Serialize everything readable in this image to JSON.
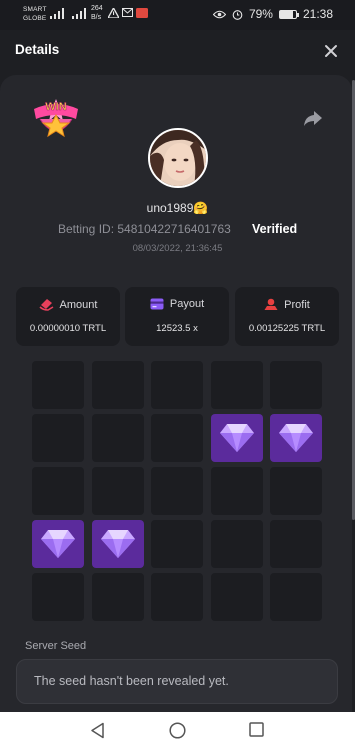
{
  "status_bar": {
    "carrier_line1": "SMART",
    "carrier_line2": "GLOBE",
    "net_speed_value": "264",
    "net_speed_unit": "B/s",
    "battery": "79%",
    "time": "21:38",
    "battery_level": 0.79
  },
  "header": {
    "title": "Details"
  },
  "bet": {
    "username": "uno1989🤗",
    "betting_id_label": "Betting ID:",
    "betting_id": "54810422716401763",
    "verified": "Verified",
    "datetime": "08/03/2022, 21:36:45",
    "badge_text": "WIN"
  },
  "stats": {
    "amount": {
      "label": "Amount",
      "value": "0.00000010 TRTL"
    },
    "payout": {
      "label": "Payout",
      "value": "12523.5 x"
    },
    "profit": {
      "label": "Profit",
      "value": "0.00125225 TRTL"
    }
  },
  "grid": {
    "rows": 5,
    "cols": 5,
    "gems": [
      [
        1,
        3
      ],
      [
        1,
        4
      ],
      [
        3,
        0
      ],
      [
        3,
        1
      ]
    ]
  },
  "server_seed": {
    "label": "Server Seed",
    "value": "The seed hasn't been revealed yet."
  },
  "colors": {
    "gem_tile": "#5b2b9c",
    "tile": "#1c1d21",
    "panel": "#26272c",
    "amount_icon": "#e8405c",
    "payout_icon": "#8b5cf6",
    "profit_icon": "#e84040"
  }
}
